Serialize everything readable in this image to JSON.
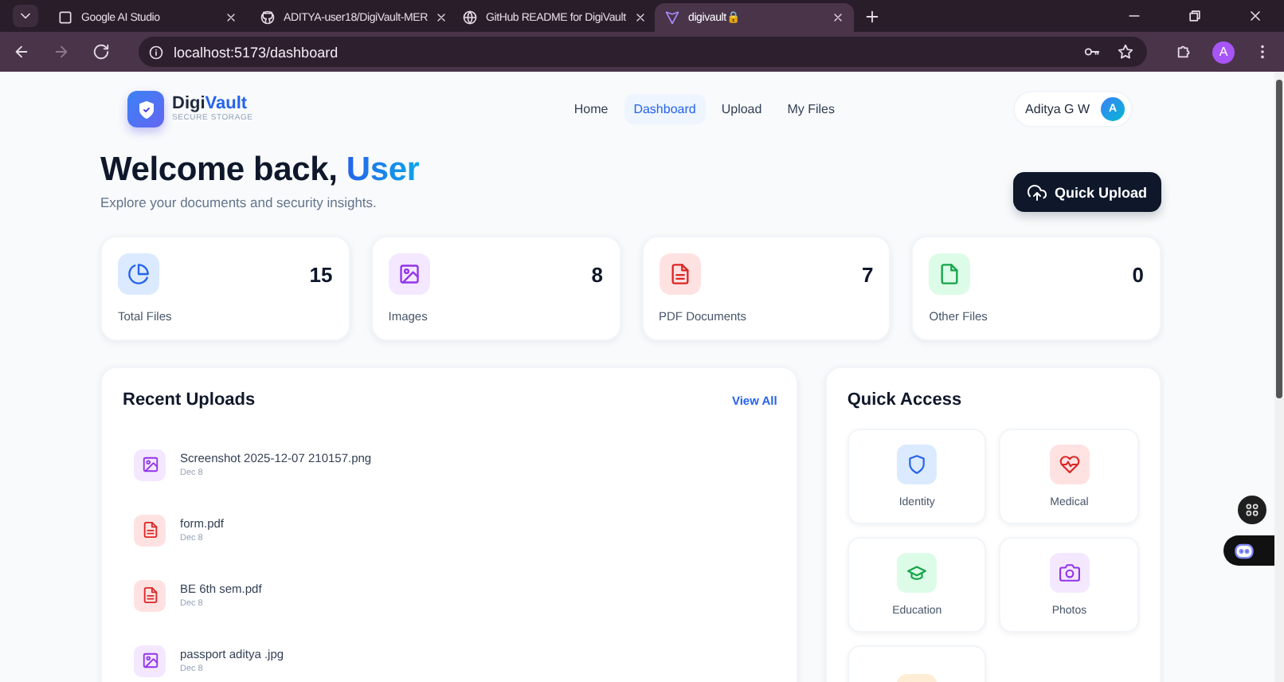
{
  "browser": {
    "tabs": [
      {
        "title": "Google AI Studio",
        "kind": "ai",
        "selected": false
      },
      {
        "title": "ADITYA-user18/DigiVault-MER",
        "kind": "github",
        "selected": false
      },
      {
        "title": "GitHub README for DigiVault",
        "kind": "globe",
        "selected": false
      },
      {
        "title": "digivault🔒",
        "kind": "vite",
        "selected": true
      }
    ],
    "url": "localhost:5173/dashboard",
    "profile": "A"
  },
  "app": {
    "logo": {
      "name_dark": "Digi",
      "name_accent": "Vault",
      "tagline": "SECURE STORAGE"
    },
    "nav": [
      {
        "label": "Home",
        "selected": false
      },
      {
        "label": "Dashboard",
        "selected": true
      },
      {
        "label": "Upload",
        "selected": false
      },
      {
        "label": "My Files",
        "selected": false
      }
    ],
    "user": {
      "name": "Aditya G W",
      "initial": "A"
    }
  },
  "welcome": {
    "greeting": "Welcome back,",
    "name": "User",
    "subtitle": "Explore your documents and security insights.",
    "action": "Quick Upload"
  },
  "stats": [
    {
      "kind": "total",
      "value": "15",
      "label": "Total Files"
    },
    {
      "kind": "image",
      "value": "8",
      "label": "Images"
    },
    {
      "kind": "pdf",
      "value": "7",
      "label": "PDF Documents"
    },
    {
      "kind": "other",
      "value": "0",
      "label": "Other Files"
    }
  ],
  "recent_uploads": {
    "title": "Recent Uploads",
    "link": "View All",
    "items": [
      {
        "kind": "image",
        "name": "Screenshot 2025-12-07 210157.png",
        "date": "Dec 8"
      },
      {
        "kind": "pdf",
        "name": "form.pdf",
        "date": "Dec 8"
      },
      {
        "kind": "pdf",
        "name": "BE 6th sem.pdf",
        "date": "Dec 8"
      },
      {
        "kind": "image",
        "name": "passport aditya .jpg",
        "date": "Dec 8"
      }
    ]
  },
  "quick_access": {
    "title": "Quick Access",
    "items": [
      {
        "kind": "identity",
        "label": "Identity"
      },
      {
        "kind": "medical",
        "label": "Medical"
      },
      {
        "kind": "education",
        "label": "Education"
      },
      {
        "kind": "photos",
        "label": "Photos"
      },
      {
        "kind": "work"
      }
    ]
  }
}
